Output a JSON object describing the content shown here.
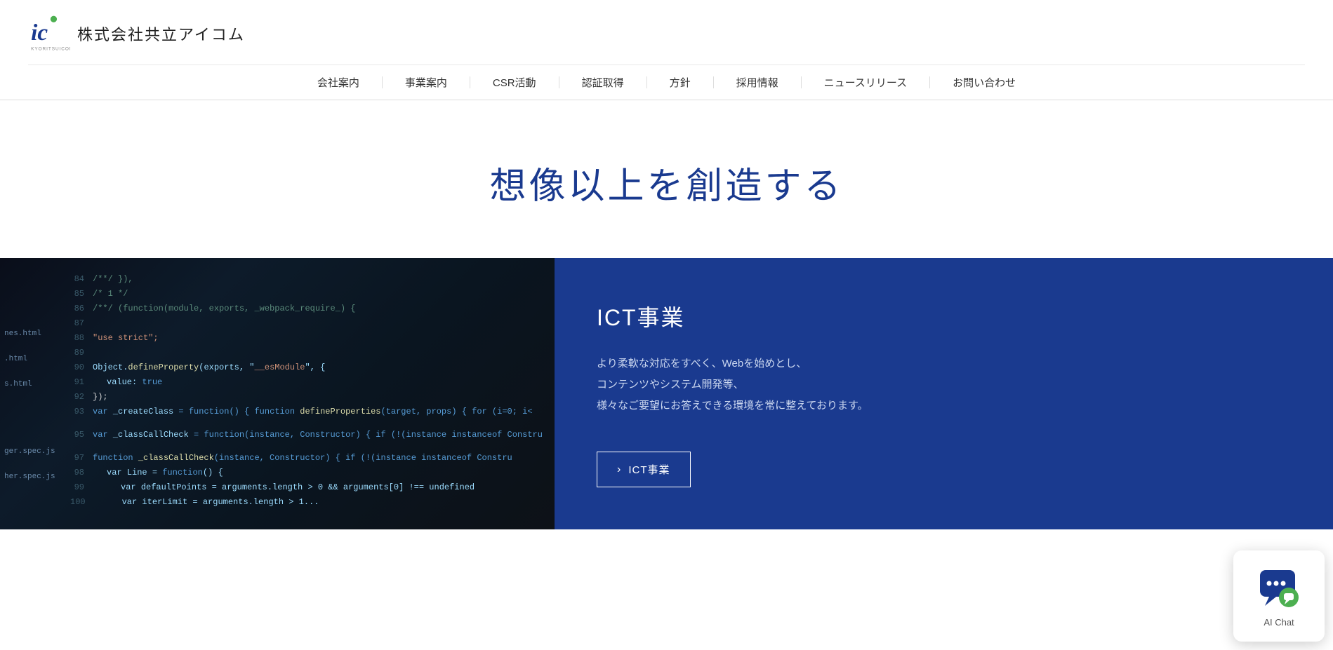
{
  "header": {
    "logo_company": "株式会社共立アイコム",
    "logo_sub": "KYORITSUICOM",
    "nav_items": [
      "会社案内",
      "事業案内",
      "CSR活動",
      "認証取得",
      "方針",
      "採用情報",
      "ニュースリリース",
      "お問い合わせ"
    ]
  },
  "hero": {
    "title": "想像以上を創造する"
  },
  "ict_section": {
    "title": "ICT事業",
    "description_line1": "より柔軟な対応をすべく、Webを始めとし、",
    "description_line2": "コンテンツやシステム開発等、",
    "description_line3": "様々なご要望にお答えできる環境を常に整えております。",
    "button_label": "ICT事業"
  },
  "ai_chat": {
    "label": "AI Chat"
  },
  "colors": {
    "brand_blue": "#1a3a8f",
    "nav_border": "#dddddd",
    "hero_title": "#1a3a8f"
  }
}
